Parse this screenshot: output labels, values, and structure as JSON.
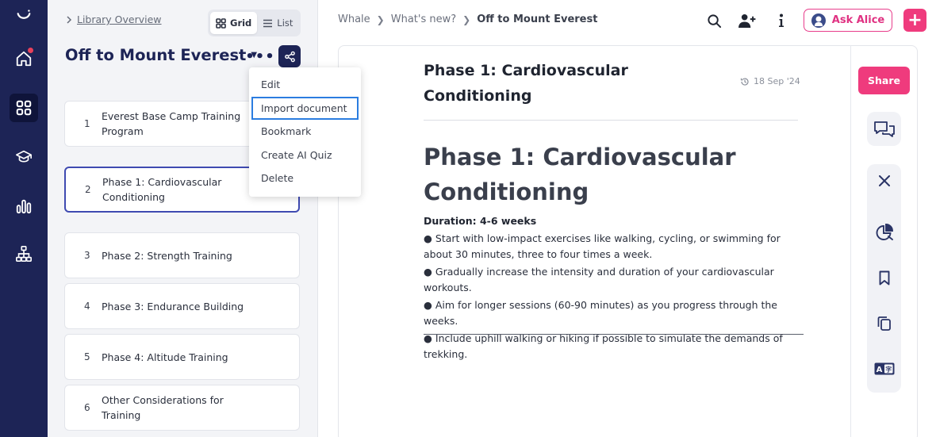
{
  "nav": {
    "items": [
      "logo",
      "home",
      "library",
      "learning",
      "analytics",
      "org-chart"
    ]
  },
  "library": {
    "overview_link": "Library Overview",
    "view_grid": "Grid",
    "view_list": "List",
    "doc_title": "Off to Mount Everest",
    "chapters": [
      {
        "num": "1",
        "label": "Everest Base Camp Training Program"
      },
      {
        "num": "2",
        "label": "Phase 1: Cardiovascular Conditioning"
      },
      {
        "num": "3",
        "label": "Phase 2: Strength Training"
      },
      {
        "num": "4",
        "label": "Phase 3: Endurance Building"
      },
      {
        "num": "5",
        "label": "Phase 4: Altitude Training"
      },
      {
        "num": "6",
        "label": "Other Considerations for Training"
      }
    ]
  },
  "menu": {
    "items": [
      "Edit",
      "Import document",
      "Bookmark",
      "Create AI Quiz",
      "Delete"
    ]
  },
  "breadcrumb": {
    "items": [
      "Whale",
      "What's new?",
      "Off to Mount Everest"
    ]
  },
  "topbar": {
    "ask_label": "Ask Alice",
    "plus": "+"
  },
  "page": {
    "heading": "Phase 1: Cardiovascular Conditioning",
    "date": "18 Sep '24",
    "h1": "Phase 1: Cardiovascular Conditioning",
    "duration": "Duration: 4-6 weeks",
    "bullets": [
      "● Start with low-impact exercises like walking, cycling, or swimming for about 30 minutes, three to four times a week.",
      "● Gradually increase the intensity and duration of your cardiovascular workouts.",
      "● Aim for longer sessions (60-90 minutes) as you progress through the weeks.",
      "● Include uphill walking or hiking if possible to simulate the demands of trekking."
    ]
  },
  "side": {
    "share_label": "Share"
  },
  "colors": {
    "rail": "#1d2456",
    "accent": "#ef3b7d",
    "focus": "#2b7de0"
  }
}
